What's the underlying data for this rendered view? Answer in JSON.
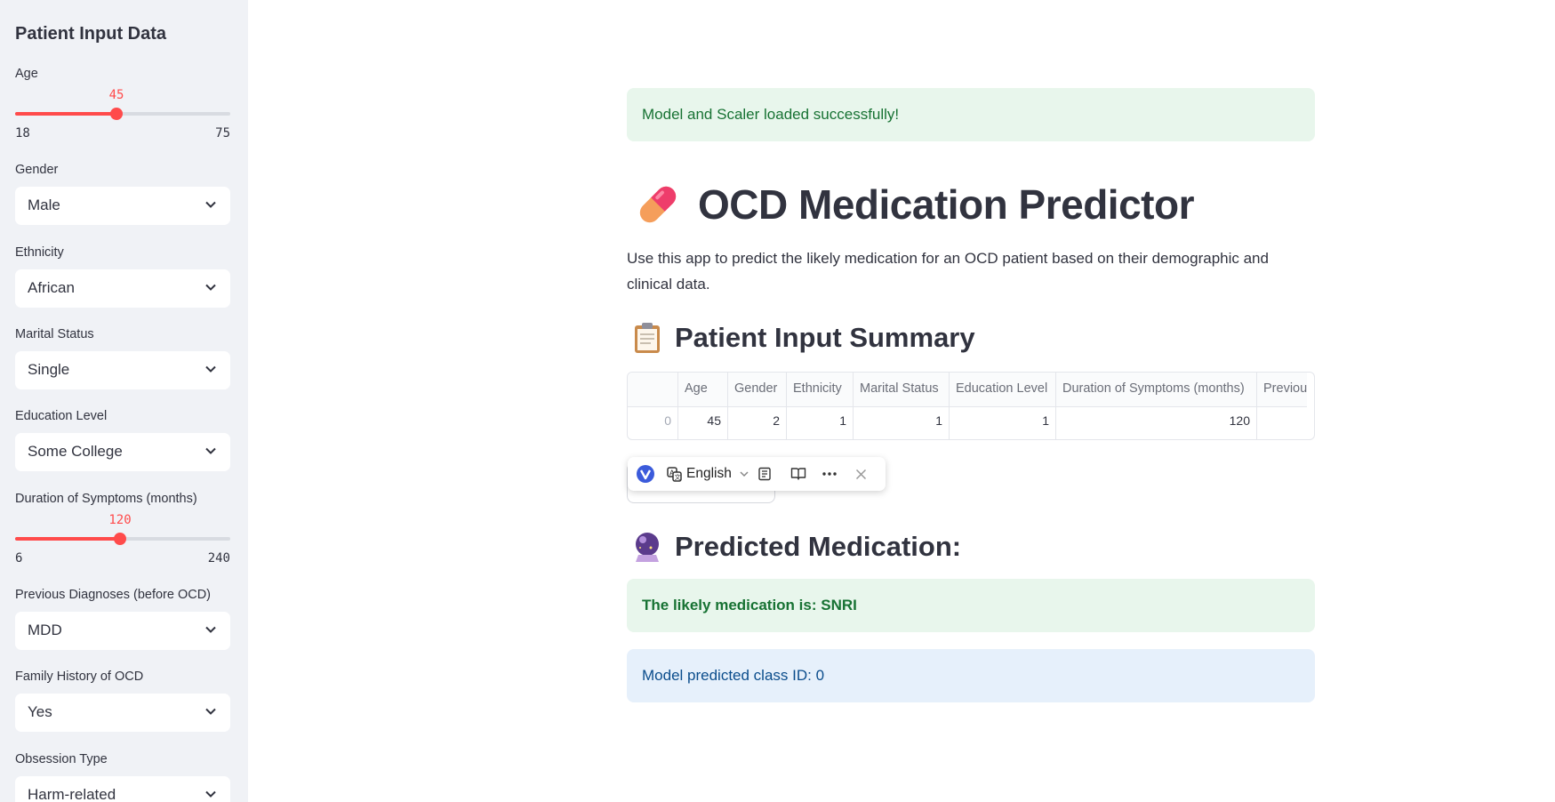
{
  "sidebar": {
    "title": "Patient Input Data",
    "age": {
      "label": "Age",
      "value": "45",
      "min": "18",
      "max": "75",
      "fraction": 0.474
    },
    "gender": {
      "label": "Gender",
      "value": "Male"
    },
    "ethnicity": {
      "label": "Ethnicity",
      "value": "African"
    },
    "marital_status": {
      "label": "Marital Status",
      "value": "Single"
    },
    "education_level": {
      "label": "Education Level",
      "value": "Some College"
    },
    "duration": {
      "label": "Duration of Symptoms (months)",
      "value": "120",
      "min": "6",
      "max": "240",
      "fraction": 0.487
    },
    "previous_diagnoses": {
      "label": "Previous Diagnoses (before OCD)",
      "value": "MDD"
    },
    "family_history": {
      "label": "Family History of OCD",
      "value": "Yes"
    },
    "obsession_type": {
      "label": "Obsession Type",
      "value": "Harm-related"
    }
  },
  "main": {
    "load_success": "Model and Scaler loaded successfully!",
    "title": "OCD Medication Predictor",
    "description": "Use this app to predict the likely medication for an OCD patient based on their demographic and clinical data.",
    "summary_heading": "Patient Input Summary",
    "table": {
      "columns": [
        "",
        "Age",
        "Gender",
        "Ethnicity",
        "Marital Status",
        "Education Level",
        "Duration of Symptoms (months)",
        "Previous"
      ],
      "row": [
        "0",
        "45",
        "2",
        "1",
        "1",
        "1",
        "120",
        ""
      ]
    },
    "prediction_heading": "Predicted Medication:",
    "prediction_result": "The likely medication is: SNRI",
    "class_id": "Model predicted class ID: 0"
  },
  "translate_toolbar": {
    "language": "English",
    "icons": [
      "translator-logo-icon",
      "translate-icon",
      "chevron-down-icon",
      "page-icon",
      "book-icon",
      "more-icon",
      "close-icon"
    ]
  },
  "colors": {
    "accent": "#ff4b4b",
    "sidebar_bg": "#f0f2f6",
    "success_bg": "#e8f6ec",
    "success_text": "#177233",
    "info_bg": "#e6f0fb",
    "info_text": "#0b4d8c"
  }
}
